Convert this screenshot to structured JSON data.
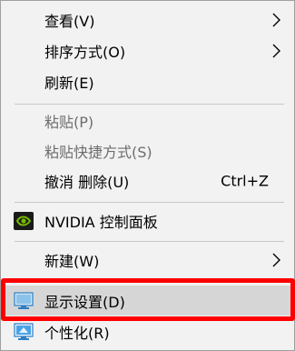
{
  "context_menu": {
    "items": [
      {
        "label": "查看(V)",
        "submenu": true
      },
      {
        "label": "排序方式(O)",
        "submenu": true
      },
      {
        "label": "刷新(E)"
      },
      {
        "label": "粘贴(P)",
        "disabled": true
      },
      {
        "label": "粘贴快捷方式(S)",
        "disabled": true
      },
      {
        "label": "撤消 删除(U)",
        "shortcut": "Ctrl+Z"
      },
      {
        "label": "NVIDIA 控制面板",
        "icon": "nvidia-icon"
      },
      {
        "label": "新建(W)",
        "submenu": true
      },
      {
        "label": "显示设置(D)",
        "icon": "display-settings-icon",
        "highlighted": true
      },
      {
        "label": "个性化(R)",
        "icon": "personalize-icon"
      }
    ]
  },
  "colors": {
    "menu_background": "#f2f2f2",
    "hover_background": "#d6d6d6",
    "highlight_border": "#ff0000",
    "disabled_text": "#6d6d6d",
    "nvidia_green": "#76b900"
  }
}
